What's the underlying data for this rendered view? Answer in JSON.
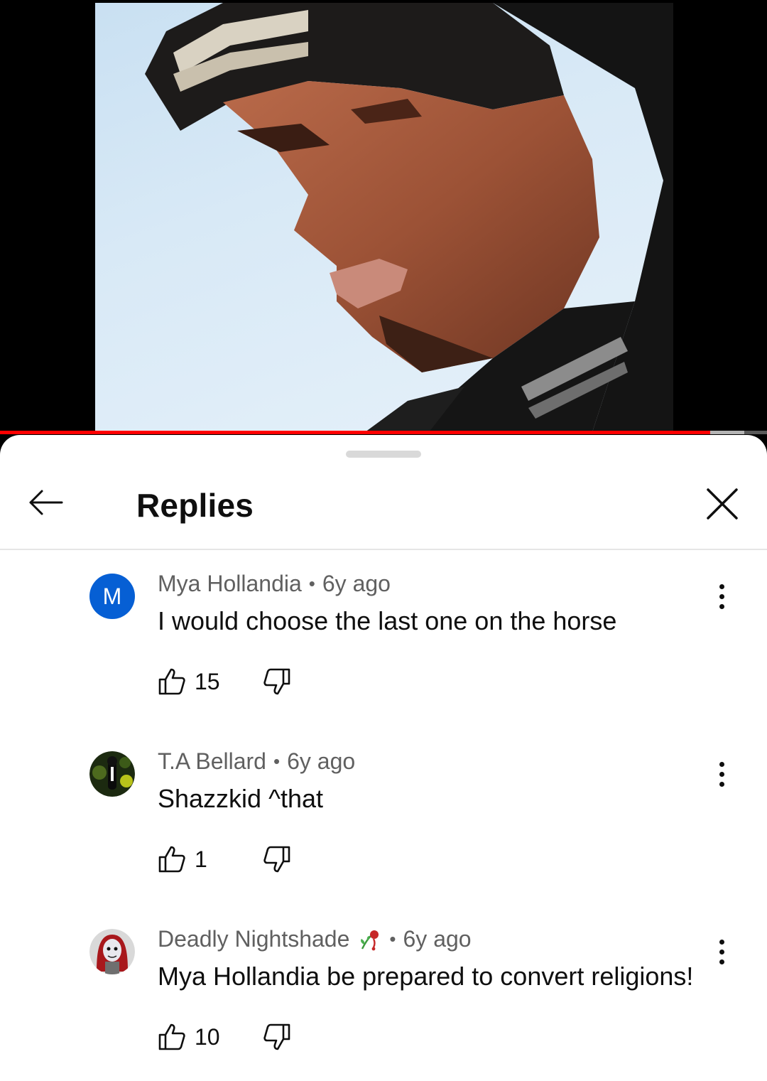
{
  "player": {
    "progress_fraction": 0.926,
    "buffer_fraction": 0.97,
    "accent_color": "#ff0000"
  },
  "header": {
    "title": "Replies",
    "back_icon": "arrow-left-icon",
    "close_icon": "close-icon"
  },
  "replies": [
    {
      "author": "Mya Hollandia",
      "separator": "•",
      "time": "6y ago",
      "text": "I would  choose the last one on the horse",
      "likes": "15",
      "avatar_letter": "M",
      "avatar_color": "#065fd4"
    },
    {
      "author": "T.A Bellard",
      "separator": "•",
      "time": "6y ago",
      "text": "Shazzkid ^that",
      "likes": "1",
      "avatar_icon": "user-photo-avatar"
    },
    {
      "author": "Deadly Nightshade",
      "separator": "•",
      "time": "6y ago",
      "text": "Mya Hollandia be prepared to convert religions!",
      "likes": "10",
      "author_emoji": "wilted-rose-icon",
      "avatar_icon": "character-avatar"
    }
  ]
}
